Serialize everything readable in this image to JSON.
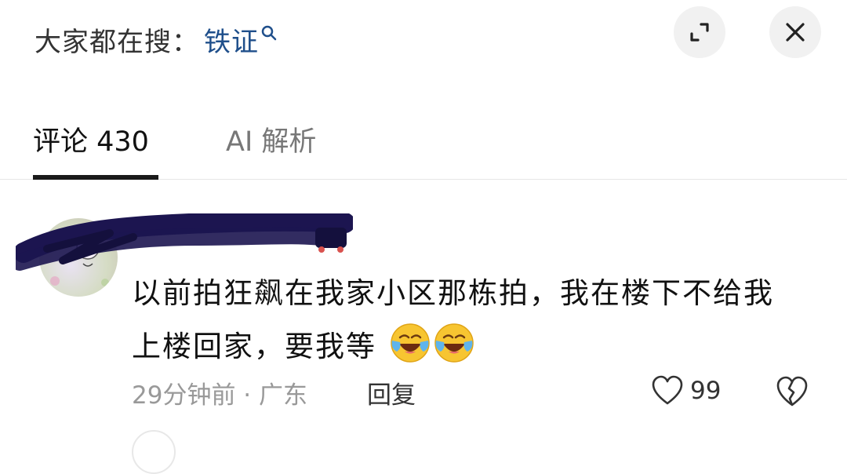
{
  "search": {
    "prefix": "大家都在搜：",
    "term": "铁证"
  },
  "tabs": [
    {
      "label": "评论 430",
      "active": true
    },
    {
      "label": "AI 解析",
      "active": false
    }
  ],
  "comment": {
    "text_line1": "以前拍狂飙在我家小区那栋拍，我在楼下不给我",
    "text_line2": "上楼回家，要我等",
    "emojis": [
      "laughing-crying-emoji",
      "laughing-crying-emoji"
    ],
    "time_location": "29分钟前 · 广东",
    "reply_label": "回复",
    "likes": "99"
  },
  "colors": {
    "search_term": "#1f4f8b",
    "scribble": "#1c1550",
    "button_bg": "#f1f1f1"
  }
}
